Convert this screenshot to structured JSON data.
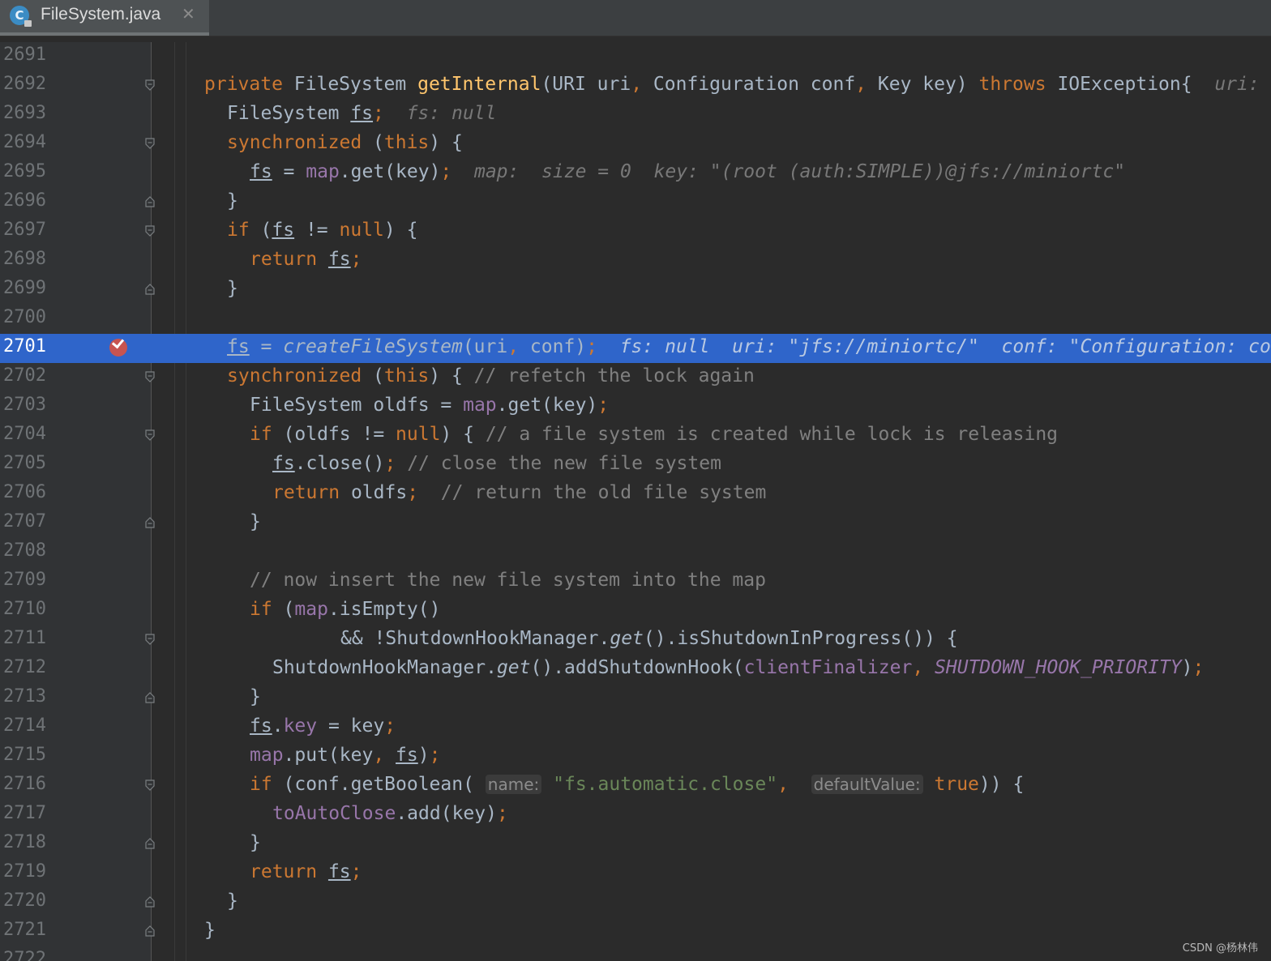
{
  "tab": {
    "title": "FileSystem.java",
    "icon": "java-class-icon",
    "close": "✕"
  },
  "watermark": "CSDN @杨林伟",
  "lines": [
    {
      "n": "2691",
      "fold": null,
      "indent": 0,
      "current": false,
      "bp": false,
      "tokens": []
    },
    {
      "n": "2692",
      "fold": "start",
      "indent": 0,
      "current": false,
      "bp": false,
      "tokens": [
        {
          "t": "private ",
          "c": "k"
        },
        {
          "t": "FileSystem "
        },
        {
          "t": "getInternal",
          "c": "f"
        },
        {
          "t": "(URI uri"
        },
        {
          "t": ", ",
          "c": "k"
        },
        {
          "t": "Configuration conf"
        },
        {
          "t": ", ",
          "c": "k"
        },
        {
          "t": "Key key) "
        },
        {
          "t": "throws ",
          "c": "k"
        },
        {
          "t": "IOException{  "
        },
        {
          "t": "uri: \"jfs://miniortc/\"",
          "c": "h"
        }
      ]
    },
    {
      "n": "2693",
      "fold": null,
      "indent": 1,
      "current": false,
      "bp": false,
      "tokens": [
        {
          "t": "FileSystem "
        },
        {
          "t": "fs",
          "c": "u"
        },
        {
          "t": ";",
          "c": "k"
        },
        {
          "t": "  fs: null",
          "c": "h"
        }
      ]
    },
    {
      "n": "2694",
      "fold": "start",
      "indent": 1,
      "current": false,
      "bp": false,
      "tokens": [
        {
          "t": "synchronized ",
          "c": "k"
        },
        {
          "t": "("
        },
        {
          "t": "this",
          "c": "k"
        },
        {
          "t": ") {"
        }
      ]
    },
    {
      "n": "2695",
      "fold": null,
      "indent": 2,
      "current": false,
      "bp": false,
      "tokens": [
        {
          "t": "fs",
          "c": "u"
        },
        {
          "t": " = "
        },
        {
          "t": "map",
          "c": "p"
        },
        {
          "t": ".get(key)"
        },
        {
          "t": ";",
          "c": "k"
        },
        {
          "t": "  map:  size = 0  key: \"(root (auth:SIMPLE))@jfs://miniortc\"",
          "c": "h"
        }
      ]
    },
    {
      "n": "2696",
      "fold": "end",
      "indent": 1,
      "current": false,
      "bp": false,
      "tokens": [
        {
          "t": "}"
        }
      ]
    },
    {
      "n": "2697",
      "fold": "start",
      "indent": 1,
      "current": false,
      "bp": false,
      "tokens": [
        {
          "t": "if ",
          "c": "k"
        },
        {
          "t": "("
        },
        {
          "t": "fs",
          "c": "u"
        },
        {
          "t": " != "
        },
        {
          "t": "null",
          "c": "k"
        },
        {
          "t": ") {"
        }
      ]
    },
    {
      "n": "2698",
      "fold": null,
      "indent": 2,
      "current": false,
      "bp": false,
      "tokens": [
        {
          "t": "return ",
          "c": "k"
        },
        {
          "t": "fs",
          "c": "u"
        },
        {
          "t": ";",
          "c": "k"
        }
      ]
    },
    {
      "n": "2699",
      "fold": "end",
      "indent": 1,
      "current": false,
      "bp": false,
      "tokens": [
        {
          "t": "}"
        }
      ]
    },
    {
      "n": "2700",
      "fold": null,
      "indent": 0,
      "current": false,
      "bp": false,
      "tokens": []
    },
    {
      "n": "2701",
      "fold": null,
      "indent": 1,
      "current": true,
      "bp": true,
      "tokens": [
        {
          "t": "fs",
          "c": "u"
        },
        {
          "t": " = "
        },
        {
          "t": "createFileSystem",
          "c": "it"
        },
        {
          "t": "(uri"
        },
        {
          "t": ", ",
          "c": "k"
        },
        {
          "t": "conf)"
        },
        {
          "t": ";",
          "c": "k"
        },
        {
          "t": "  fs: null  uri: \"jfs://miniortc/\"  conf: \"Configuration: core-default.xml\"",
          "c": "h"
        }
      ]
    },
    {
      "n": "2702",
      "fold": "start",
      "indent": 1,
      "current": false,
      "bp": false,
      "tokens": [
        {
          "t": "synchronized ",
          "c": "k"
        },
        {
          "t": "("
        },
        {
          "t": "this",
          "c": "k"
        },
        {
          "t": ") { "
        },
        {
          "t": "// refetch the lock again",
          "c": "c"
        }
      ]
    },
    {
      "n": "2703",
      "fold": null,
      "indent": 2,
      "current": false,
      "bp": false,
      "tokens": [
        {
          "t": "FileSystem oldfs = "
        },
        {
          "t": "map",
          "c": "p"
        },
        {
          "t": ".get(key)"
        },
        {
          "t": ";",
          "c": "k"
        }
      ]
    },
    {
      "n": "2704",
      "fold": "start",
      "indent": 2,
      "current": false,
      "bp": false,
      "tokens": [
        {
          "t": "if ",
          "c": "k"
        },
        {
          "t": "(oldfs != "
        },
        {
          "t": "null",
          "c": "k"
        },
        {
          "t": ") { "
        },
        {
          "t": "// a file system is created while lock is releasing",
          "c": "c"
        }
      ]
    },
    {
      "n": "2705",
      "fold": null,
      "indent": 3,
      "current": false,
      "bp": false,
      "tokens": [
        {
          "t": "fs",
          "c": "u"
        },
        {
          "t": ".close()"
        },
        {
          "t": ";",
          "c": "k"
        },
        {
          "t": " "
        },
        {
          "t": "// close the new file system",
          "c": "c"
        }
      ]
    },
    {
      "n": "2706",
      "fold": null,
      "indent": 3,
      "current": false,
      "bp": false,
      "tokens": [
        {
          "t": "return ",
          "c": "k"
        },
        {
          "t": "oldfs"
        },
        {
          "t": ";",
          "c": "k"
        },
        {
          "t": "  "
        },
        {
          "t": "// return the old file system",
          "c": "c"
        }
      ]
    },
    {
      "n": "2707",
      "fold": "end",
      "indent": 2,
      "current": false,
      "bp": false,
      "tokens": [
        {
          "t": "}"
        }
      ]
    },
    {
      "n": "2708",
      "fold": null,
      "indent": 0,
      "current": false,
      "bp": false,
      "tokens": []
    },
    {
      "n": "2709",
      "fold": null,
      "indent": 2,
      "current": false,
      "bp": false,
      "tokens": [
        {
          "t": "// now insert the new file system into the map",
          "c": "c"
        }
      ]
    },
    {
      "n": "2710",
      "fold": null,
      "indent": 2,
      "current": false,
      "bp": false,
      "tokens": [
        {
          "t": "if ",
          "c": "k"
        },
        {
          "t": "("
        },
        {
          "t": "map",
          "c": "p"
        },
        {
          "t": ".isEmpty()"
        }
      ]
    },
    {
      "n": "2711",
      "fold": "start",
      "indent": 6,
      "current": false,
      "bp": false,
      "tokens": [
        {
          "t": "&& !ShutdownHookManager."
        },
        {
          "t": "get",
          "c": "it"
        },
        {
          "t": "().isShutdownInProgress()) {"
        }
      ]
    },
    {
      "n": "2712",
      "fold": null,
      "indent": 3,
      "current": false,
      "bp": false,
      "tokens": [
        {
          "t": "ShutdownHookManager."
        },
        {
          "t": "get",
          "c": "it"
        },
        {
          "t": "().addShutdownHook("
        },
        {
          "t": "clientFinalizer",
          "c": "p"
        },
        {
          "t": ", ",
          "c": "k"
        },
        {
          "t": "SHUTDOWN_HOOK_PRIORITY",
          "c": "pi"
        },
        {
          "t": ")"
        },
        {
          "t": ";",
          "c": "k"
        }
      ]
    },
    {
      "n": "2713",
      "fold": "end",
      "indent": 2,
      "current": false,
      "bp": false,
      "tokens": [
        {
          "t": "}"
        }
      ]
    },
    {
      "n": "2714",
      "fold": null,
      "indent": 2,
      "current": false,
      "bp": false,
      "tokens": [
        {
          "t": "fs",
          "c": "u"
        },
        {
          "t": "."
        },
        {
          "t": "key",
          "c": "p"
        },
        {
          "t": " = key"
        },
        {
          "t": ";",
          "c": "k"
        }
      ]
    },
    {
      "n": "2715",
      "fold": null,
      "indent": 2,
      "current": false,
      "bp": false,
      "tokens": [
        {
          "t": "map",
          "c": "p"
        },
        {
          "t": ".put(key"
        },
        {
          "t": ", ",
          "c": "k"
        },
        {
          "t": "fs",
          "c": "u"
        },
        {
          "t": ")"
        },
        {
          "t": ";",
          "c": "k"
        }
      ]
    },
    {
      "n": "2716",
      "fold": "start",
      "indent": 2,
      "current": false,
      "bp": false,
      "tokens": [
        {
          "t": "if ",
          "c": "k"
        },
        {
          "t": "(conf.getBoolean( "
        },
        {
          "t": "name:",
          "c": "hint"
        },
        {
          "t": " "
        },
        {
          "t": "\"fs.automatic.close\"",
          "c": "s"
        },
        {
          "t": ",  ",
          "c": "k"
        },
        {
          "t": "defaultValue:",
          "c": "hint"
        },
        {
          "t": " "
        },
        {
          "t": "true",
          "c": "k"
        },
        {
          "t": ")) {"
        }
      ]
    },
    {
      "n": "2717",
      "fold": null,
      "indent": 3,
      "current": false,
      "bp": false,
      "tokens": [
        {
          "t": "toAutoClose",
          "c": "p"
        },
        {
          "t": ".add(key)"
        },
        {
          "t": ";",
          "c": "k"
        }
      ]
    },
    {
      "n": "2718",
      "fold": "end",
      "indent": 2,
      "current": false,
      "bp": false,
      "tokens": [
        {
          "t": "}"
        }
      ]
    },
    {
      "n": "2719",
      "fold": null,
      "indent": 2,
      "current": false,
      "bp": false,
      "tokens": [
        {
          "t": "return ",
          "c": "k"
        },
        {
          "t": "fs",
          "c": "u"
        },
        {
          "t": ";",
          "c": "k"
        }
      ]
    },
    {
      "n": "2720",
      "fold": "end",
      "indent": 1,
      "current": false,
      "bp": false,
      "tokens": [
        {
          "t": "}"
        }
      ]
    },
    {
      "n": "2721",
      "fold": "end",
      "indent": 0,
      "current": false,
      "bp": false,
      "tokens": [
        {
          "t": "}"
        }
      ]
    },
    {
      "n": "2722",
      "fold": null,
      "indent": 0,
      "current": false,
      "bp": false,
      "tokens": []
    }
  ]
}
